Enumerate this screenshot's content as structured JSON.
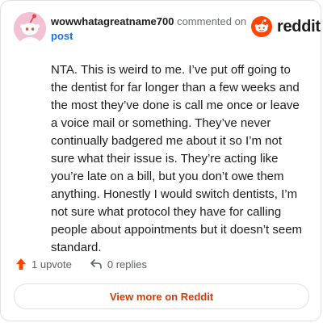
{
  "header": {
    "username": "wowwhatagreatname700",
    "commented_text": "commented on",
    "post_link": "post"
  },
  "brand": {
    "name": "reddit",
    "icon": "reddit-logo-icon",
    "color": "#ff4500"
  },
  "comment": {
    "body": "NTA. This is weird to me. I’ve put off going to the dentist for far longer than a few weeks and the most they’ve done is call me once or leave a voice mail or something. They’ve never continually badgered me about it so I’m not sure what their issue is. They’re acting like you’re late on a bill, but you don’t owe them anything. Honestly I would switch dentists, I’m not sure what protocol they have for calling people about appointments but it doesn’t seem standard."
  },
  "actions": {
    "upvote_label": "1 upvote",
    "upvote_icon": "upvote-arrow-icon",
    "replies_label": "0 replies",
    "replies_icon": "reply-arrow-icon"
  },
  "view_more": {
    "label": "View more on Reddit"
  },
  "colors": {
    "accent": "#d93a00",
    "upvote": "#ff4500",
    "link": "#1f6fd9",
    "avatar_bg": "#f3c0d4"
  }
}
